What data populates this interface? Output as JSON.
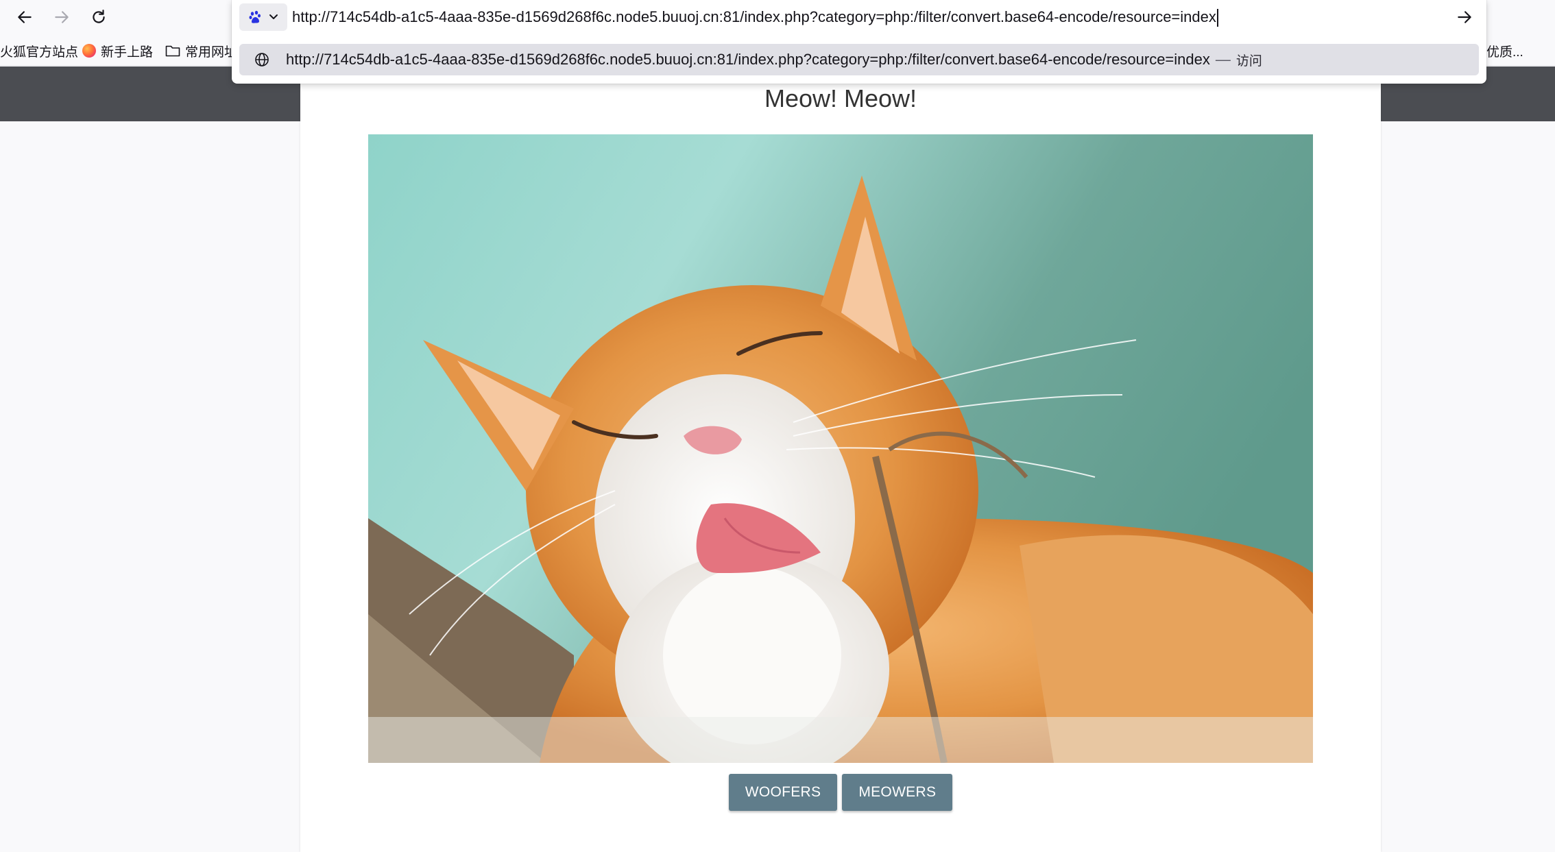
{
  "browser": {
    "url_text": "http://714c54db-a1c5-4aaa-835e-d1569d268f6c.node5.buuoj.cn:81/index.php?category=php:/filter/convert.base64-encode/resource=index",
    "suggestion": {
      "url": "http://714c54db-a1c5-4aaa-835e-d1569d268f6c.node5.buuoj.cn:81/index.php?category=php:/filter/convert.base64-encode/resource=index",
      "separator": "—",
      "action": "访问"
    },
    "search_engine_icon": "baidu-paw-icon"
  },
  "bookmarks": [
    {
      "label": "火狐官方站点",
      "icon": "none"
    },
    {
      "label": "新手上路",
      "icon": "firefox-icon"
    },
    {
      "label": "常用网址",
      "icon": "folder-icon"
    }
  ],
  "bookmarks_overflow": "优质...",
  "page": {
    "title": "Meow! Meow!",
    "image_subject": "ginger-white-cat-licking-paw",
    "buttons": [
      "WOOFERS",
      "MEOWERS"
    ],
    "accent_color": "#607d8b",
    "header_color": "#4b4d52"
  }
}
